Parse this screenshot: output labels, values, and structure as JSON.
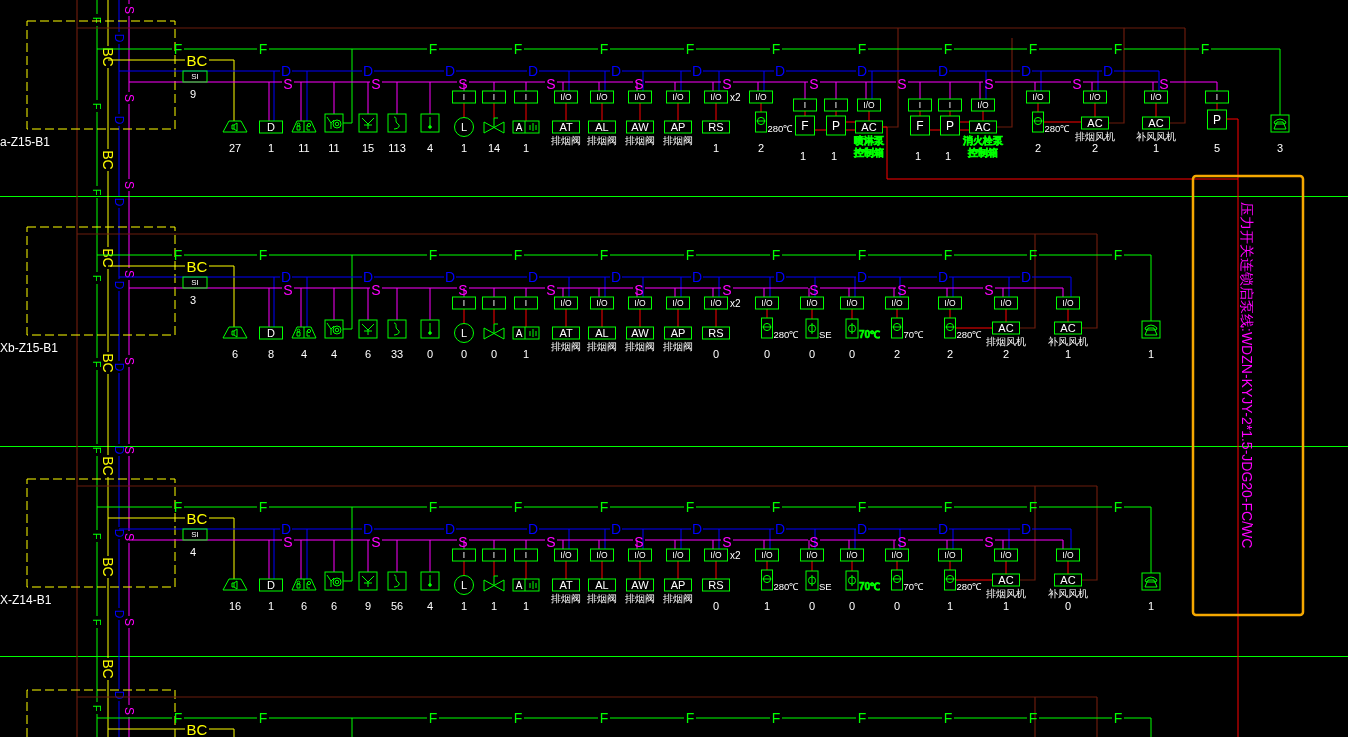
{
  "riser": {
    "f_labels": [
      "F",
      "F",
      "F",
      "F",
      "F",
      "F",
      "F",
      "F",
      "F"
    ],
    "bc_labels": [
      "BC",
      "BC",
      "BC",
      "BC",
      "BC",
      "BC",
      "BC"
    ],
    "d_labels": [
      "D",
      "D",
      "D",
      "D",
      "D",
      "D",
      "D",
      "D",
      "D"
    ],
    "s_labels": [
      "S",
      "S",
      "S",
      "S",
      "S",
      "S",
      "S",
      "S",
      "S"
    ]
  },
  "rows": [
    {
      "panel": "a-Z15-B1",
      "bc": "BC",
      "si": {
        "label": "SI",
        "count": "9"
      },
      "f_bus": [
        "F",
        "F",
        "F",
        "F",
        "F",
        "F",
        "F",
        "F",
        "F",
        "F",
        "F",
        "F"
      ],
      "d_bus": [
        "D",
        "D",
        "D",
        "D",
        "D",
        "D",
        "D",
        "D",
        "D",
        "D",
        "D"
      ],
      "s_bus": [
        "S",
        "S",
        "S",
        "S",
        "S",
        "S",
        "S",
        "S",
        "S",
        "S",
        "S"
      ],
      "devices": [
        {
          "kind": "sounder",
          "count": "27"
        },
        {
          "kind": "box",
          "text": "D",
          "count": "1"
        },
        {
          "kind": "dual_trapezoid",
          "count": "11"
        },
        {
          "kind": "fork_target",
          "count": "11"
        },
        {
          "kind": "fork_cross",
          "count": "15"
        },
        {
          "kind": "zigzag",
          "count": "113"
        },
        {
          "kind": "line_dot",
          "count": "4"
        },
        {
          "kind": "lamp",
          "module": "I",
          "text": "L",
          "count": "1"
        },
        {
          "kind": "valve",
          "module": "I",
          "count": "14"
        },
        {
          "kind": "meter",
          "module": "I",
          "text": "A",
          "count": "1"
        },
        {
          "kind": "box",
          "module": "I/O",
          "text": "AT",
          "note": [
            "排烟阀"
          ]
        },
        {
          "kind": "box",
          "module": "I/O",
          "text": "AL",
          "note": [
            "排烟阀"
          ]
        },
        {
          "kind": "box",
          "module": "I/O",
          "text": "AW",
          "note": [
            "排烟阀"
          ]
        },
        {
          "kind": "box",
          "module": "I/O",
          "text": "AP",
          "note": [
            "排烟阀"
          ]
        },
        {
          "kind": "box",
          "module": "I/O",
          "multiplier": "x2",
          "text": "RS",
          "count": "1"
        },
        {
          "kind": "damper",
          "module": "I/O",
          "tag": "280℃",
          "count": "2"
        },
        {
          "kind": "square",
          "module": "I",
          "text": "F",
          "count": "1"
        },
        {
          "kind": "square",
          "module": "I",
          "text": "P",
          "count": "1"
        },
        {
          "kind": "box",
          "module": "I/O",
          "text": "AC",
          "note": [
            "喷淋泵",
            "控制箱"
          ],
          "color": "#00ff00"
        },
        {
          "kind": "square",
          "module": "I",
          "text": "F",
          "count": "1"
        },
        {
          "kind": "square",
          "module": "I",
          "text": "P",
          "count": "1"
        },
        {
          "kind": "box",
          "module": "I/O",
          "text": "AC",
          "note": [
            "消火栓泵",
            "控制箱"
          ],
          "color": "#00ff00"
        },
        {
          "kind": "damper",
          "module": "I/O",
          "tag": "280℃",
          "count": "2"
        },
        {
          "kind": "box",
          "module": "I/O",
          "text": "AC",
          "note": [
            "排烟风机"
          ],
          "count": "2"
        },
        {
          "kind": "box",
          "module": "I/O",
          "text": "AC",
          "note": [
            "补风风机"
          ],
          "count": "1"
        },
        {
          "kind": "square",
          "module": "I",
          "text": "P",
          "count": "5"
        },
        {
          "kind": "phone",
          "count": "3"
        }
      ]
    },
    {
      "panel": "Xb-Z15-B1",
      "bc": "BC",
      "si": {
        "label": "SI",
        "count": "3"
      },
      "f_bus": [
        "F",
        "F",
        "F",
        "F",
        "F",
        "F",
        "F",
        "F",
        "F",
        "F",
        "F"
      ],
      "d_bus": [
        "D",
        "D",
        "D",
        "D",
        "D",
        "D",
        "D",
        "D",
        "D",
        "D"
      ],
      "s_bus": [
        "S",
        "S",
        "S",
        "S",
        "S",
        "S",
        "S",
        "S",
        "S"
      ],
      "devices": [
        {
          "kind": "sounder",
          "count": "6"
        },
        {
          "kind": "box",
          "text": "D",
          "count": "8"
        },
        {
          "kind": "dual_trapezoid",
          "count": "4"
        },
        {
          "kind": "fork_target",
          "count": "4"
        },
        {
          "kind": "fork_cross",
          "count": "6"
        },
        {
          "kind": "zigzag",
          "count": "33"
        },
        {
          "kind": "line_dot",
          "count": "0"
        },
        {
          "kind": "lamp",
          "module": "I",
          "text": "L",
          "count": "0"
        },
        {
          "kind": "valve",
          "module": "I",
          "count": "0"
        },
        {
          "kind": "meter",
          "module": "I",
          "text": "A",
          "count": "1"
        },
        {
          "kind": "box",
          "module": "I/O",
          "text": "AT",
          "note": [
            "排烟阀"
          ]
        },
        {
          "kind": "box",
          "module": "I/O",
          "text": "AL",
          "note": [
            "排烟阀"
          ]
        },
        {
          "kind": "box",
          "module": "I/O",
          "text": "AW",
          "note": [
            "排烟阀"
          ]
        },
        {
          "kind": "box",
          "module": "I/O",
          "text": "AP",
          "note": [
            "排烟阀"
          ]
        },
        {
          "kind": "box",
          "module": "I/O",
          "multiplier": "x2",
          "text": "RS",
          "count": "0"
        },
        {
          "kind": "damper",
          "module": "I/O",
          "tag": "280℃",
          "count": "0"
        },
        {
          "kind": "phi",
          "module": "I/O",
          "tag": "SE",
          "count": "0"
        },
        {
          "kind": "phi",
          "module": "I/O",
          "tag": "70℃",
          "color": "#00ff00",
          "count": "0"
        },
        {
          "kind": "damper",
          "module": "I/O",
          "tag": "70℃",
          "count": "2"
        },
        {
          "kind": "damper",
          "module": "I/O",
          "tag": "280℃",
          "count": "2"
        },
        {
          "kind": "box",
          "module": "I/O",
          "text": "AC",
          "note": [
            "排烟风机"
          ],
          "count": "2"
        },
        {
          "kind": "box",
          "module": "I/O",
          "text": "AC",
          "note": [
            "补风风机"
          ],
          "count": "1"
        },
        {
          "kind": "phone",
          "count": "1"
        }
      ]
    },
    {
      "panel": "X-Z14-B1",
      "bc": "BC",
      "si": {
        "label": "SI",
        "count": "4"
      },
      "f_bus": [
        "F",
        "F",
        "F",
        "F",
        "F",
        "F",
        "F",
        "F",
        "F",
        "F",
        "F"
      ],
      "d_bus": [
        "D",
        "D",
        "D",
        "D",
        "D",
        "D",
        "D",
        "D",
        "D",
        "D"
      ],
      "s_bus": [
        "S",
        "S",
        "S",
        "S",
        "S",
        "S",
        "S",
        "S",
        "S"
      ],
      "devices": [
        {
          "kind": "sounder",
          "count": "16"
        },
        {
          "kind": "box",
          "text": "D",
          "count": "1"
        },
        {
          "kind": "dual_trapezoid",
          "count": "6"
        },
        {
          "kind": "fork_target",
          "count": "6"
        },
        {
          "kind": "fork_cross",
          "count": "9"
        },
        {
          "kind": "zigzag",
          "count": "56"
        },
        {
          "kind": "line_dot",
          "count": "4"
        },
        {
          "kind": "lamp",
          "module": "I",
          "text": "L",
          "count": "1"
        },
        {
          "kind": "valve",
          "module": "I",
          "count": "1"
        },
        {
          "kind": "meter",
          "module": "I",
          "text": "A",
          "count": "1"
        },
        {
          "kind": "box",
          "module": "I/O",
          "text": "AT",
          "note": [
            "排烟阀"
          ]
        },
        {
          "kind": "box",
          "module": "I/O",
          "text": "AL",
          "note": [
            "排烟阀"
          ]
        },
        {
          "kind": "box",
          "module": "I/O",
          "text": "AW",
          "note": [
            "排烟阀"
          ]
        },
        {
          "kind": "box",
          "module": "I/O",
          "text": "AP",
          "note": [
            "排烟阀"
          ]
        },
        {
          "kind": "box",
          "module": "I/O",
          "multiplier": "x2",
          "text": "RS",
          "count": "0"
        },
        {
          "kind": "damper",
          "module": "I/O",
          "tag": "280℃",
          "count": "1"
        },
        {
          "kind": "phi",
          "module": "I/O",
          "tag": "SE",
          "count": "0"
        },
        {
          "kind": "phi",
          "module": "I/O",
          "tag": "70℃",
          "color": "#00ff00",
          "count": "0"
        },
        {
          "kind": "damper",
          "module": "I/O",
          "tag": "70℃",
          "count": "0"
        },
        {
          "kind": "damper",
          "module": "I/O",
          "tag": "280℃",
          "count": "1"
        },
        {
          "kind": "box",
          "module": "I/O",
          "text": "AC",
          "note": [
            "排烟风机"
          ],
          "count": "1"
        },
        {
          "kind": "box",
          "module": "I/O",
          "text": "AC",
          "note": [
            "补风风机"
          ],
          "count": "0"
        },
        {
          "kind": "phone",
          "count": "1"
        }
      ]
    },
    {
      "bc": "BC",
      "f_bus": [
        "F",
        "F",
        "F",
        "F",
        "F",
        "F",
        "F",
        "F",
        "F",
        "F",
        "F"
      ]
    }
  ],
  "cable_note": "压力开关连锁启泵线:WDZN-KYJY-2*1.5-JDG20-FC/WC"
}
